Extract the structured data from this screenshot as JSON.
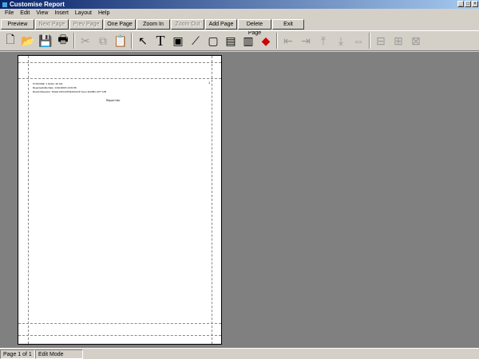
{
  "window": {
    "title": "Customise Report"
  },
  "menu": [
    "File",
    "Edit",
    "View",
    "Insert",
    "Layout",
    "Help"
  ],
  "commands": [
    {
      "label": "Preview",
      "enabled": true
    },
    {
      "label": "Next Page",
      "enabled": false
    },
    {
      "label": "Prev Page",
      "enabled": false
    },
    {
      "label": "One Page",
      "enabled": true
    },
    {
      "label": "Zoom In",
      "enabled": true
    },
    {
      "label": "Zoom Out",
      "enabled": false
    },
    {
      "label": "Add Page",
      "enabled": true
    },
    {
      "label": "Delete Page",
      "enabled": true
    },
    {
      "label": "Exit",
      "enabled": true
    }
  ],
  "toolbar_icons": [
    "new-icon",
    "open-icon",
    "save-icon",
    "print-icon",
    "cut-icon",
    "copy-icon",
    "paste-icon",
    "pointer-icon",
    "text-tool-icon",
    "image-tool-icon",
    "line-tool-icon",
    "box-tool-icon",
    "field-tool-icon",
    "formula-tool-icon",
    "color-icon",
    "align-left-icon",
    "align-right-icon",
    "align-top-icon",
    "align-bottom-icon",
    "space-horizontal-icon",
    "same-width-icon",
    "same-height-icon",
    "grid-icon"
  ],
  "report": {
    "line1": "SYSCODE: 1 OpNo: 40 Job:",
    "line2": "Reportedtofile    Date: 14/11/2015 13:01:56",
    "line3": "Result Msession: SOeld.AOV2CP3420CAl lP Feuo 32A/Bro UP7  C/B",
    "center_text": "Report Info",
    "page_marker": "1"
  },
  "status": {
    "page": "Page 1 of 1",
    "mode": "Edit Mode"
  }
}
